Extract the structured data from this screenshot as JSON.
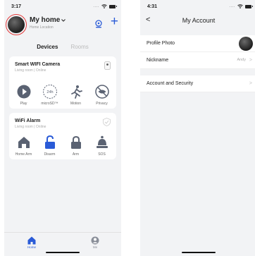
{
  "left": {
    "status": {
      "time": "3:17",
      "dots": "...."
    },
    "header": {
      "title": "My home",
      "subtitle": "Home Location",
      "plus": "+"
    },
    "tabs": [
      {
        "label": "Devices",
        "active": true
      },
      {
        "label": "Rooms",
        "active": false
      }
    ],
    "cards": [
      {
        "title": "Smart WIFI Camera",
        "subtitle": "Living room | Online",
        "actions": [
          {
            "label": "Play",
            "icon": "play-icon"
          },
          {
            "label": "microSD™",
            "icon": "sd-card-icon",
            "badge": "24h"
          },
          {
            "label": "Motion",
            "icon": "motion-icon"
          },
          {
            "label": "Privacy",
            "icon": "privacy-icon"
          }
        ]
      },
      {
        "title": "WiFi Alarm",
        "subtitle": "Living room | Online",
        "actions": [
          {
            "label": "Home Arm",
            "icon": "home-arm-icon"
          },
          {
            "label": "Disarm",
            "icon": "disarm-icon"
          },
          {
            "label": "Arm",
            "icon": "arm-icon"
          },
          {
            "label": "SOS",
            "icon": "sos-icon"
          }
        ]
      }
    ],
    "tabbar": [
      {
        "label": "Home",
        "icon": "home-icon"
      },
      {
        "label": "Me",
        "icon": "me-icon"
      }
    ],
    "colors": {
      "accent": "#2a5bd7",
      "highlight": "#e23b3b"
    }
  },
  "right": {
    "status": {
      "time": "4:31",
      "dots": "...."
    },
    "nav": {
      "back": "<",
      "title": "My Account"
    },
    "rows": {
      "photo": {
        "label": "Profile Photo"
      },
      "nickname": {
        "label": "Nickname",
        "value": "Andy",
        "chevron": ">"
      },
      "account": {
        "label": "Account and Security",
        "chevron": ">"
      }
    }
  }
}
